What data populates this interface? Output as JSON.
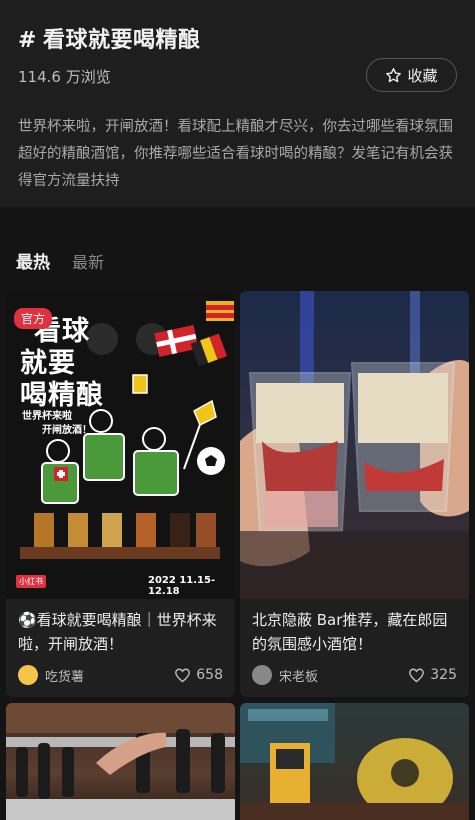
{
  "topic": {
    "hash": "#",
    "title": "看球就要喝精酿",
    "views": "114.6 万浏览",
    "favorite_label": "收藏",
    "description": "世界杯来啦，开闸放酒！看球配上精酿才尽兴，你去过哪些看球氛围超好的精酿酒馆，你推荐哪些适合看球时喝的精酿？发笔记有机会获得官方流量扶持"
  },
  "tabs": [
    {
      "label": "最热",
      "active": true
    },
    {
      "label": "最新",
      "active": false
    }
  ],
  "cards": [
    {
      "badge": "官方",
      "poster": {
        "headline_1": "看球",
        "headline_2": "就要",
        "headline_3": "喝精酿",
        "sub_1": "世界杯来啦",
        "sub_2": "开闸放酒！",
        "brand": "小红书",
        "date": "2022 11.15-12.18"
      },
      "title": "⚽️看球就要喝精酿｜世界杯来啦，开闸放酒！",
      "author": "吃货薯",
      "likes": "658"
    },
    {
      "title": "北京隐蔽 Bar推荐，藏在郎园的氛围感小酒馆！",
      "author": "宋老板",
      "likes": "325"
    }
  ],
  "colors": {
    "accent_red": "#e0313f",
    "header_bg": "#1e1e1e",
    "page_bg": "#141414",
    "poster_bg": "#121212",
    "green": "#4a9a3c",
    "yellow": "#f0c418"
  }
}
